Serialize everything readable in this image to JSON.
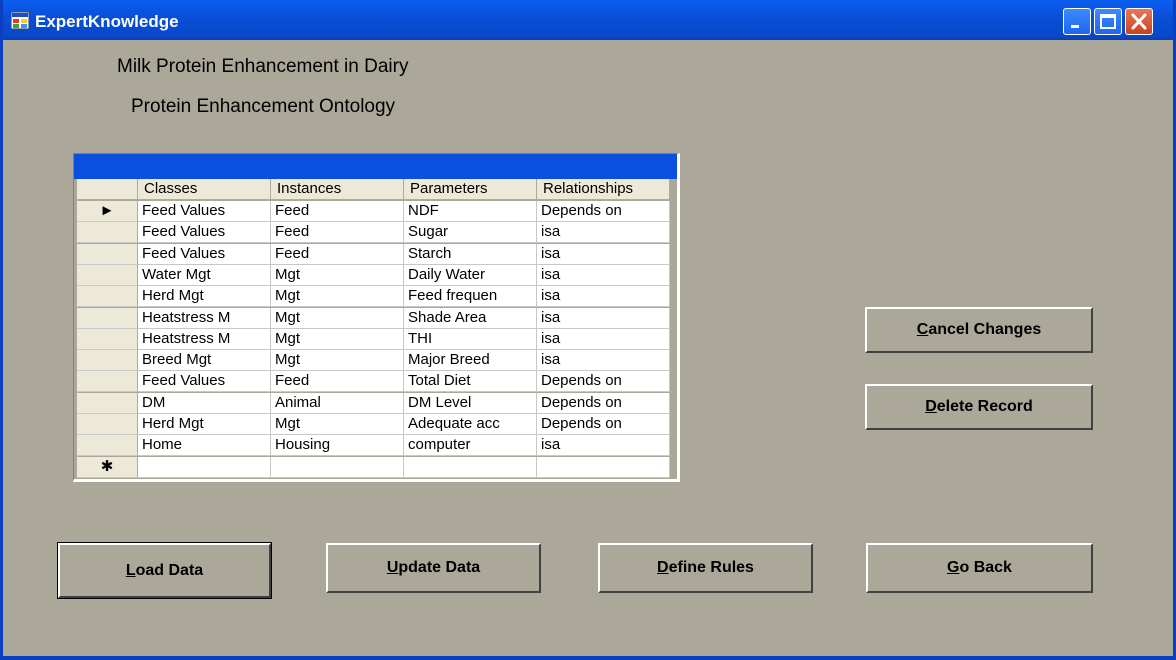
{
  "window": {
    "title": "ExpertKnowledge"
  },
  "headings": {
    "title": "Milk Protein Enhancement in Dairy",
    "subtitle": "Protein Enhancement Ontology"
  },
  "grid": {
    "columns": [
      "Classes",
      "Instances",
      "Parameters",
      "Relationships"
    ],
    "current_row_marker": "►",
    "new_row_marker": "✱",
    "rows": [
      [
        "Feed Values",
        "Feed",
        "NDF",
        "Depends on"
      ],
      [
        "Feed Values",
        "Feed",
        "Sugar",
        "isa"
      ],
      [
        "Feed Values",
        "Feed",
        "Starch",
        "isa"
      ],
      [
        "Water Mgt",
        "Mgt",
        "Daily Water",
        "isa"
      ],
      [
        "Herd Mgt",
        "Mgt",
        "Feed frequen",
        "isa"
      ],
      [
        "Heatstress M",
        "Mgt",
        "Shade Area",
        "isa"
      ],
      [
        "Heatstress M",
        "Mgt",
        "THI",
        "isa"
      ],
      [
        "Breed Mgt",
        "Mgt",
        "Major Breed",
        "isa"
      ],
      [
        "Feed Values",
        "Feed",
        "Total Diet",
        "Depends on"
      ],
      [
        "DM",
        "Animal",
        "DM Level",
        "Depends on"
      ],
      [
        "Herd Mgt",
        "Mgt",
        "Adequate acc",
        "Depends on"
      ],
      [
        "Home",
        "Housing",
        "computer",
        "isa"
      ]
    ]
  },
  "buttons": {
    "cancel_changes": "Cancel Changes",
    "delete_record": "Delete Record",
    "load_data": "Load Data",
    "update_data": "Update Data",
    "define_rules": "Define Rules",
    "go_back": "Go Back"
  },
  "colors": {
    "titlebar": "#0a4fd8",
    "form_background": "#aca899",
    "grid_caption": "#0b4fe0"
  }
}
